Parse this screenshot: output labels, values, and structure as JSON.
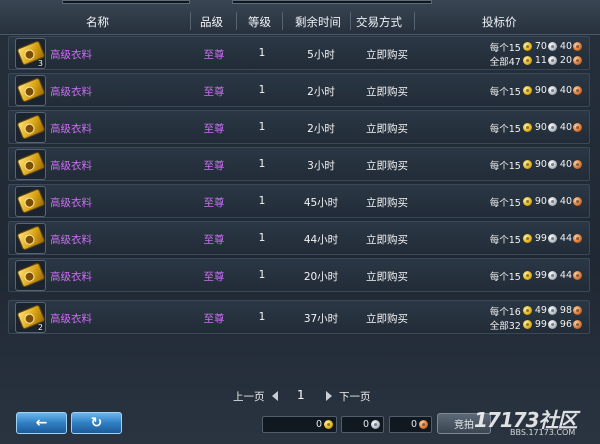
{
  "header": {
    "name": "名称",
    "quality": "品级",
    "level": "等级",
    "time_left": "剩余时间",
    "trade_mode": "交易方式",
    "bid_price": "投标价"
  },
  "rows": [
    {
      "name": "高级衣料",
      "quality": "至尊",
      "level": "1",
      "time_left": "5小时",
      "trade": "立即购买",
      "count": "3",
      "prices": [
        {
          "label": "每个15",
          "gold": "70",
          "silver": "40"
        },
        {
          "label": "全部47",
          "gold": "11",
          "silver": "20"
        }
      ]
    },
    {
      "name": "高级衣料",
      "quality": "至尊",
      "level": "1",
      "time_left": "2小时",
      "trade": "立即购买",
      "count": "",
      "prices": [
        {
          "label": "每个15",
          "gold": "90",
          "silver": "40"
        }
      ]
    },
    {
      "name": "高级衣料",
      "quality": "至尊",
      "level": "1",
      "time_left": "2小时",
      "trade": "立即购买",
      "count": "",
      "prices": [
        {
          "label": "每个15",
          "gold": "90",
          "silver": "40"
        }
      ]
    },
    {
      "name": "高级衣料",
      "quality": "至尊",
      "level": "1",
      "time_left": "3小时",
      "trade": "立即购买",
      "count": "",
      "prices": [
        {
          "label": "每个15",
          "gold": "90",
          "silver": "40"
        }
      ]
    },
    {
      "name": "高级衣料",
      "quality": "至尊",
      "level": "1",
      "time_left": "45小时",
      "trade": "立即购买",
      "count": "",
      "prices": [
        {
          "label": "每个15",
          "gold": "90",
          "silver": "40"
        }
      ]
    },
    {
      "name": "高级衣料",
      "quality": "至尊",
      "level": "1",
      "time_left": "44小时",
      "trade": "立即购买",
      "count": "",
      "prices": [
        {
          "label": "每个15",
          "gold": "99",
          "silver": "44"
        }
      ]
    },
    {
      "name": "高级衣料",
      "quality": "至尊",
      "level": "1",
      "time_left": "20小时",
      "trade": "立即购买",
      "count": "",
      "prices": [
        {
          "label": "每个15",
          "gold": "99",
          "silver": "44"
        }
      ]
    },
    {
      "name": "高级衣料",
      "quality": "至尊",
      "level": "1",
      "time_left": "37小时",
      "trade": "立即购买",
      "count": "2",
      "prices": [
        {
          "label": "每个16",
          "gold": "49",
          "silver": "98"
        },
        {
          "label": "全部32",
          "gold": "99",
          "silver": "96"
        }
      ]
    }
  ],
  "pager": {
    "prev": "上一页",
    "page": "1",
    "next": "下一页"
  },
  "bottom": {
    "back_icon": "arrow-left-icon",
    "refresh_icon": "refresh-icon",
    "gold_value": "0",
    "silver_value": "0",
    "copper_value": "0",
    "action_label": "竞拍"
  },
  "watermark": {
    "logo": "17173社区",
    "url": "BBS.17173.COM"
  },
  "colors": {
    "quality_purple": "#c96ef2",
    "gold_coin": "#e3b014",
    "silver_coin": "#b4bcc4",
    "copper_coin": "#d9722a"
  }
}
